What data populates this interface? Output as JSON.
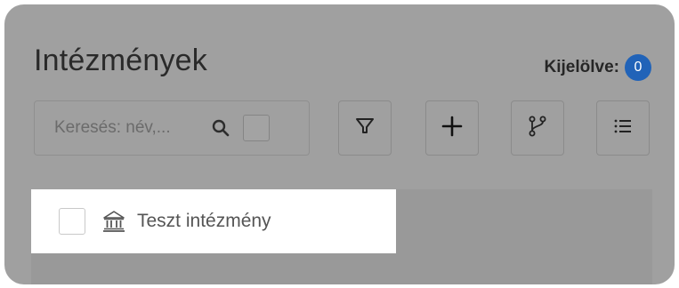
{
  "header": {
    "title": "Intézmények",
    "selected_label": "Kijelölve:",
    "selected_count": "0"
  },
  "search": {
    "placeholder": "Keresés: név,..."
  },
  "toolbar": {
    "buttons": [
      {
        "icon": "filter-icon"
      },
      {
        "icon": "plus-icon"
      },
      {
        "icon": "branch-icon"
      },
      {
        "icon": "list-icon"
      }
    ]
  },
  "list": {
    "items": [
      {
        "label": "Teszt intézmény",
        "icon": "bank-icon",
        "checked": false
      }
    ]
  },
  "colors": {
    "overlay": "#a0a0a0",
    "badge": "#2163b8",
    "item_background": "#ffffff"
  }
}
